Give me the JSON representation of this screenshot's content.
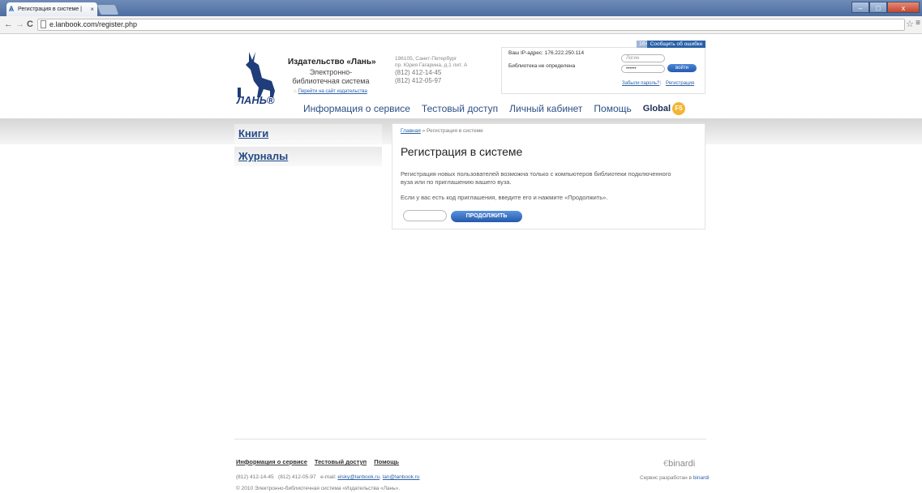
{
  "browser": {
    "tab_title": "Регистрация в системе |",
    "tab_close": "×",
    "url": "e.lanbook.com/register.php",
    "back": "←",
    "forward": "→",
    "reload": "C",
    "star": "☆",
    "menu": "≡",
    "win_min": "–",
    "win_max": "□",
    "win_close": "x"
  },
  "header": {
    "logo_text": "ЛАНЬ®",
    "publisher_name": "Издательство «Лань»",
    "publisher_sub": "Электронно-библиотечная система",
    "publisher_link": "Перейти на сайт издательства",
    "address_line1": "196105, Санкт-Петербург",
    "address_line2": "пр. Юрия Гагарина, д.1 лит. А",
    "phone1": "(812) 412-14-45",
    "phone2": "(812) 412-05-97"
  },
  "login": {
    "age_badge": "16+",
    "report_error": "Сообщить об ошибке",
    "ip_label": "Ваш IP-адрес: 176.222.250.114",
    "library_status": "Библиотека не определена",
    "login_placeholder": "Логин",
    "password_value": "••••••",
    "login_button": "войти",
    "forgot_password": "Забыли пароль?",
    "separator": "|",
    "register_link": "Регистрация"
  },
  "nav": {
    "items": [
      "Информация о сервисе",
      "Тестовый доступ",
      "Личный кабинет",
      "Помощь"
    ],
    "global_label": "Global",
    "global_badge": "F5"
  },
  "sidebar": {
    "items": [
      "Книги",
      "Журналы"
    ]
  },
  "content": {
    "breadcrumb_home": "Главная",
    "breadcrumb_sep": "»",
    "breadcrumb_current": "Регистрация в системе",
    "title": "Регистрация в системе",
    "paragraph1": "Регистрация новых пользователей возможна только с компьютеров библиотеки подключенного вуза или по приглашению вашего вуза.",
    "paragraph2": "Если у вас есть код приглашения, введите его и нажмите «Продолжить».",
    "invite_value": "",
    "continue_button": "ПРОДОЛЖИТЬ"
  },
  "footer": {
    "links": [
      "Информация о сервисе",
      "Тестовый доступ",
      "Помощь"
    ],
    "phone1": "(812) 412-14-45",
    "phone2": "(812) 412-05-97",
    "email_label": "e-mail:",
    "email1": "elsky@lanbook.ru",
    "email_comma": ",",
    "email2": "lan@lanbook.ru",
    "copyright": "© 2010 Электронно-библиотечная система «Издательства «Лань».",
    "binardi_logo": "binardi",
    "binardi_credit_prefix": "Сервис разработан в",
    "binardi_credit_link": "binardi"
  },
  "colors": {
    "brand_blue": "#2a62a8",
    "title_blue": "#1f3d7a",
    "accent_orange": "#f3b531"
  }
}
